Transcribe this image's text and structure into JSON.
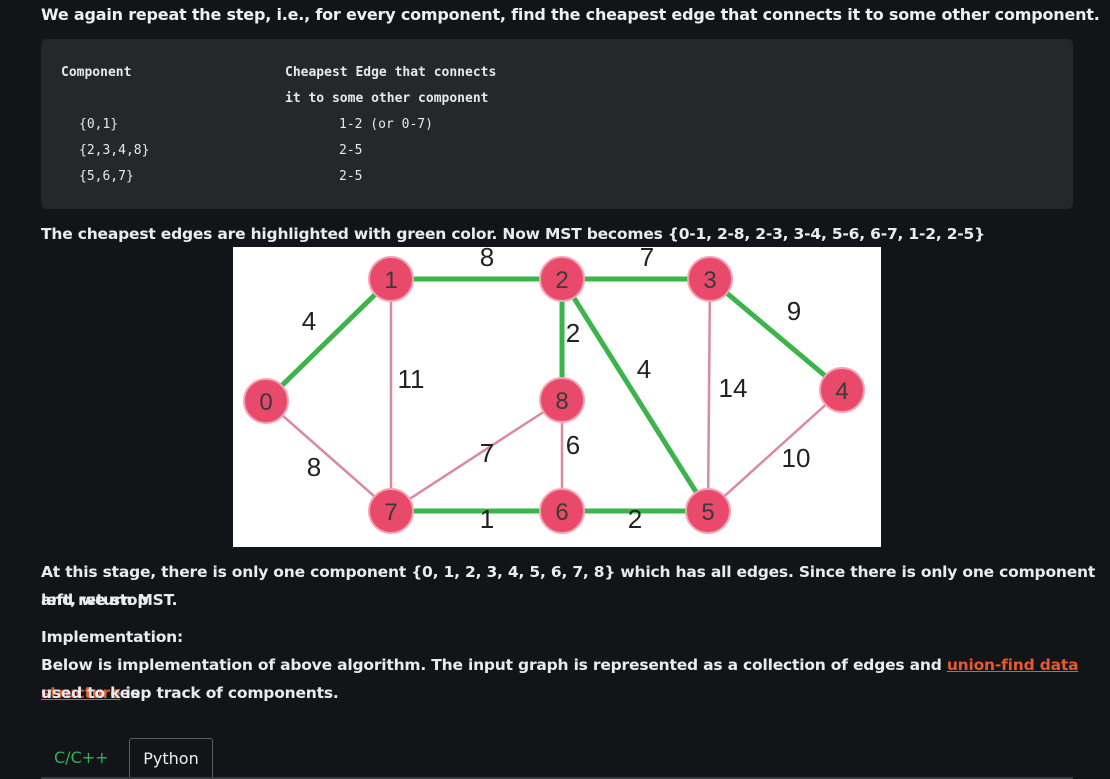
{
  "intro_text": "We again repeat the step, i.e., for every component, find the cheapest edge that connects it to some other component.",
  "table": {
    "header_col1": "Component",
    "header_col2_line1": "Cheapest Edge that connects",
    "header_col2_line2": "it to some other component",
    "rows": [
      {
        "component": "{0,1}",
        "edge": "1-2 (or 0-7)"
      },
      {
        "component": "{2,3,4,8}",
        "edge": "2-5"
      },
      {
        "component": "{5,6,7}",
        "edge": "2-5"
      }
    ]
  },
  "highlight_text": "The cheapest edges are highlighted with green color. Now MST becomes {0-1, 2-8, 2-3, 3-4, 5-6, 6-7, 1-2, 2-5}",
  "graph": {
    "colors": {
      "node": "#e9496a",
      "node_stroke": "#f6a3b3",
      "node_text": "#3a3a3a",
      "mst_edge": "#3cb44b",
      "other_edge": "#d98aa0"
    },
    "nodes": [
      "0",
      "1",
      "2",
      "3",
      "4",
      "5",
      "6",
      "7",
      "8"
    ],
    "edges": [
      {
        "u": "0",
        "v": "1",
        "w": "4",
        "mst": true
      },
      {
        "u": "1",
        "v": "2",
        "w": "8",
        "mst": true
      },
      {
        "u": "2",
        "v": "3",
        "w": "7",
        "mst": true
      },
      {
        "u": "3",
        "v": "4",
        "w": "9",
        "mst": true
      },
      {
        "u": "2",
        "v": "8",
        "w": "2",
        "mst": true
      },
      {
        "u": "2",
        "v": "5",
        "w": "4",
        "mst": true
      },
      {
        "u": "6",
        "v": "7",
        "w": "1",
        "mst": true
      },
      {
        "u": "5",
        "v": "6",
        "w": "2",
        "mst": true
      },
      {
        "u": "0",
        "v": "7",
        "w": "8",
        "mst": false
      },
      {
        "u": "1",
        "v": "7",
        "w": "11",
        "mst": false
      },
      {
        "u": "7",
        "v": "8",
        "w": "7",
        "mst": false
      },
      {
        "u": "8",
        "v": "6",
        "w": "6",
        "mst": false
      },
      {
        "u": "3",
        "v": "5",
        "w": "14",
        "mst": false
      },
      {
        "u": "4",
        "v": "5",
        "w": "10",
        "mst": false
      }
    ]
  },
  "stage_text": "At this stage, there is only one component {0, 1, 2, 3, 4, 5, 6, 7, 8} which has all edges. Since there is only one component left, we stop",
  "stage_text_2": "and return MST.",
  "impl_heading": "Implementation:",
  "impl_text_before": "Below is implementation of above algorithm. The input graph is represented as a collection of edges and ",
  "impl_link": "union-find data structure",
  "impl_text_after": " is",
  "impl_text_2": "used to keep track of components.",
  "tabs": [
    "C/C++",
    "Python"
  ],
  "active_tab": "Python"
}
